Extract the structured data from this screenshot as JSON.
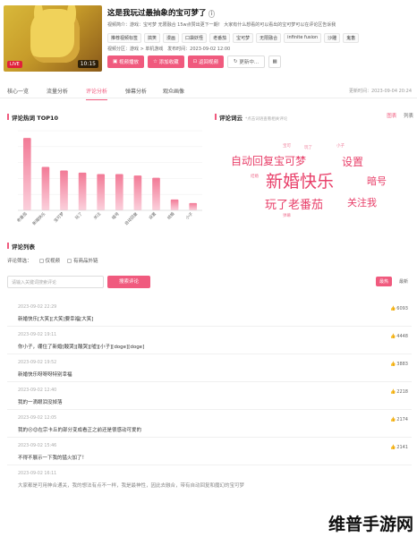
{
  "video": {
    "title": "这是我玩过最抽象的宝可梦了",
    "duration": "10:15",
    "live_badge": "LIVE",
    "intro": "视频简介：游戏：宝可梦 无限融合 15w点赞出更下一期！ 大家有什么想看的可以看出的宝可梦可以在评论区告诉我",
    "tag_label": "推荐视频标签",
    "tags": [
      "搞笑",
      "漫画",
      "口袋妖怪",
      "老番茄",
      "宝可梦",
      "无限融合",
      "infinite fusion",
      "沙雕",
      "鬼畜"
    ],
    "partition": "视频分区：游戏 > 单机游戏",
    "publish_time": "发布时间：2023-09-02 12:00",
    "buttons": [
      "视频播放",
      "添加收藏",
      "返回视频",
      "更新中..."
    ]
  },
  "tabs": [
    "核心一览",
    "流量分析",
    "评论分析",
    "弹幕分析",
    "观众画像"
  ],
  "active_tab": 2,
  "update_time": "更新时间：2023-09-04 20:24",
  "hot_comments": {
    "title": "评论热词 TOP10",
    "chart_data": {
      "type": "bar",
      "categories": [
        "老番茄",
        "新婚快乐",
        "宝可梦",
        "玩了",
        "关注",
        "暗号",
        "自动回复",
        "设置",
        "结婚",
        "小子"
      ],
      "values": [
        100,
        60,
        55,
        52,
        50,
        50,
        48,
        45,
        15,
        10
      ],
      "ylim": [
        0,
        110
      ],
      "grid": true,
      "color": "#f27a96"
    }
  },
  "word_cloud": {
    "title": "评论词云",
    "subtitle": "*点击词语查看相关评论",
    "tabs": [
      "图表",
      "列表"
    ],
    "words": [
      {
        "text": "自动回复宝可梦",
        "size": 12
      },
      {
        "text": "设置",
        "size": 12
      },
      {
        "text": "新婚快乐",
        "size": 19
      },
      {
        "text": "暗号",
        "size": 10
      },
      {
        "text": "玩了老番茄",
        "size": 13
      },
      {
        "text": "关注我",
        "size": 11
      },
      {
        "text": "宝可",
        "size": 5
      },
      {
        "text": "玩了",
        "size": 5
      },
      {
        "text": "小子",
        "size": 5
      },
      {
        "text": "结婚",
        "size": 5
      },
      {
        "text": "弹幕",
        "size": 5
      }
    ]
  },
  "comments": {
    "title": "评论列表",
    "filter_label": "评论筛选：",
    "filters": [
      "仅视频",
      "有商品外链"
    ],
    "search_placeholder": "请输入关键词搜索评论",
    "search_button": "搜索评论",
    "sort": [
      "最热",
      "最新"
    ],
    "items": [
      {
        "time": "2023-09-02 22:29",
        "text": "新婚快乐[大笑][大笑]要幸福[大笑]",
        "likes": "6093"
      },
      {
        "time": "2023-09-02 19:11",
        "text": "你小子，绷住了新婚[酸哭][酸哭][嘘][小子][doge][doge]",
        "likes": "4448"
      },
      {
        "time": "2023-09-02 19:52",
        "text": "新婚快乐呀呀呀特别幸福",
        "likes": "3883"
      },
      {
        "time": "2023-09-02 12:40",
        "text": "我的一滴眼泪没掉落",
        "likes": "2218"
      },
      {
        "time": "2023-09-02 12:05",
        "text": "我的😐😊在宗卡丘的部分变成看正之前还是很感动可爱的",
        "likes": "2174"
      },
      {
        "time": "2023-09-02 15:46",
        "text": "不得不展示一下我的猛火加了！",
        "likes": "2141"
      },
      {
        "time": "2023-09-02 16:11",
        "text": "大家都是可用神合通关，我的想法有点不一样，我是最神性，因此去融合，带有自动回复和魔幻的宝可梦",
        "likes": ""
      }
    ]
  },
  "watermark": "维普手游网"
}
